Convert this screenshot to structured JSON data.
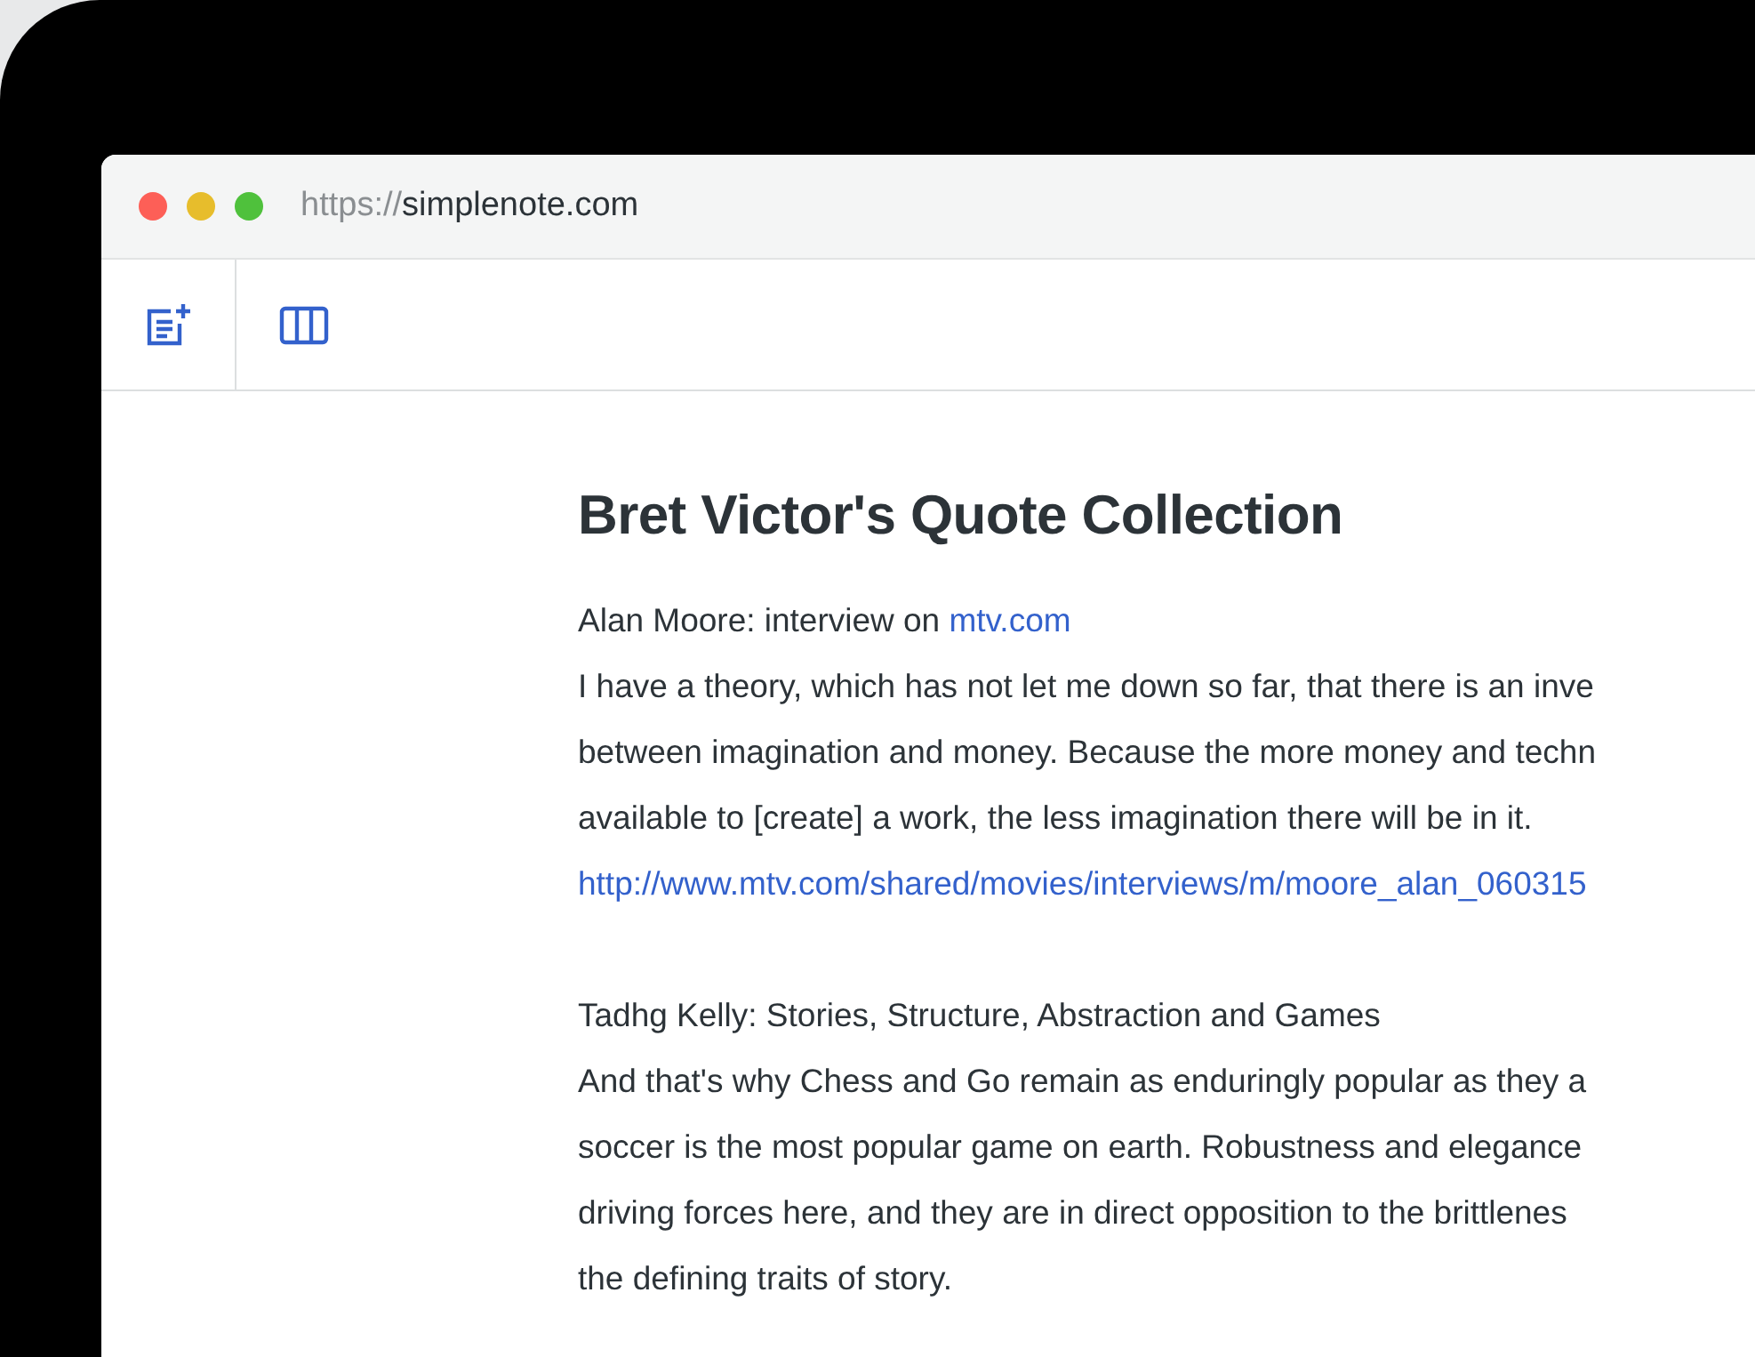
{
  "browser": {
    "dots": [
      {
        "color": "#fd5f57"
      },
      {
        "color": "#e7bd2c"
      },
      {
        "color": "#4fc13c"
      }
    ],
    "address": {
      "scheme": "https://",
      "host": "simplenote.com"
    }
  },
  "toolbar": {
    "buttons": [
      {
        "kind": "new-note"
      },
      {
        "kind": "columns"
      }
    ]
  },
  "note": {
    "title": "Bret Victor's Quote Collection",
    "sections": [
      {
        "lines": [
          {
            "kind": "source",
            "text": "Alan Moore: interview on",
            "link": "mtv.com"
          },
          {
            "kind": "text",
            "text": "I have a theory, which has not let me down so far, that there is an inve"
          },
          {
            "kind": "text",
            "text": "between imagination and money. Because the more money and techn"
          },
          {
            "kind": "text",
            "text": "available to [create] a work, the less imagination there will be in it."
          },
          {
            "kind": "url",
            "text": "http://www.mtv.com/shared/movies/interviews/m/moore_alan_060315"
          }
        ]
      },
      {
        "lines": [
          {
            "kind": "text",
            "text": "Tadhg Kelly: Stories, Structure, Abstraction and Games"
          },
          {
            "kind": "text",
            "text": "And that's why Chess and Go remain as enduringly popular as they a"
          },
          {
            "kind": "text",
            "text": "soccer is the most popular game on earth. Robustness and elegance"
          },
          {
            "kind": "text",
            "text": "driving forces here, and they are in direct opposition to the brittlenes"
          },
          {
            "kind": "text",
            "text": "the defining traits of story."
          }
        ]
      }
    ]
  }
}
